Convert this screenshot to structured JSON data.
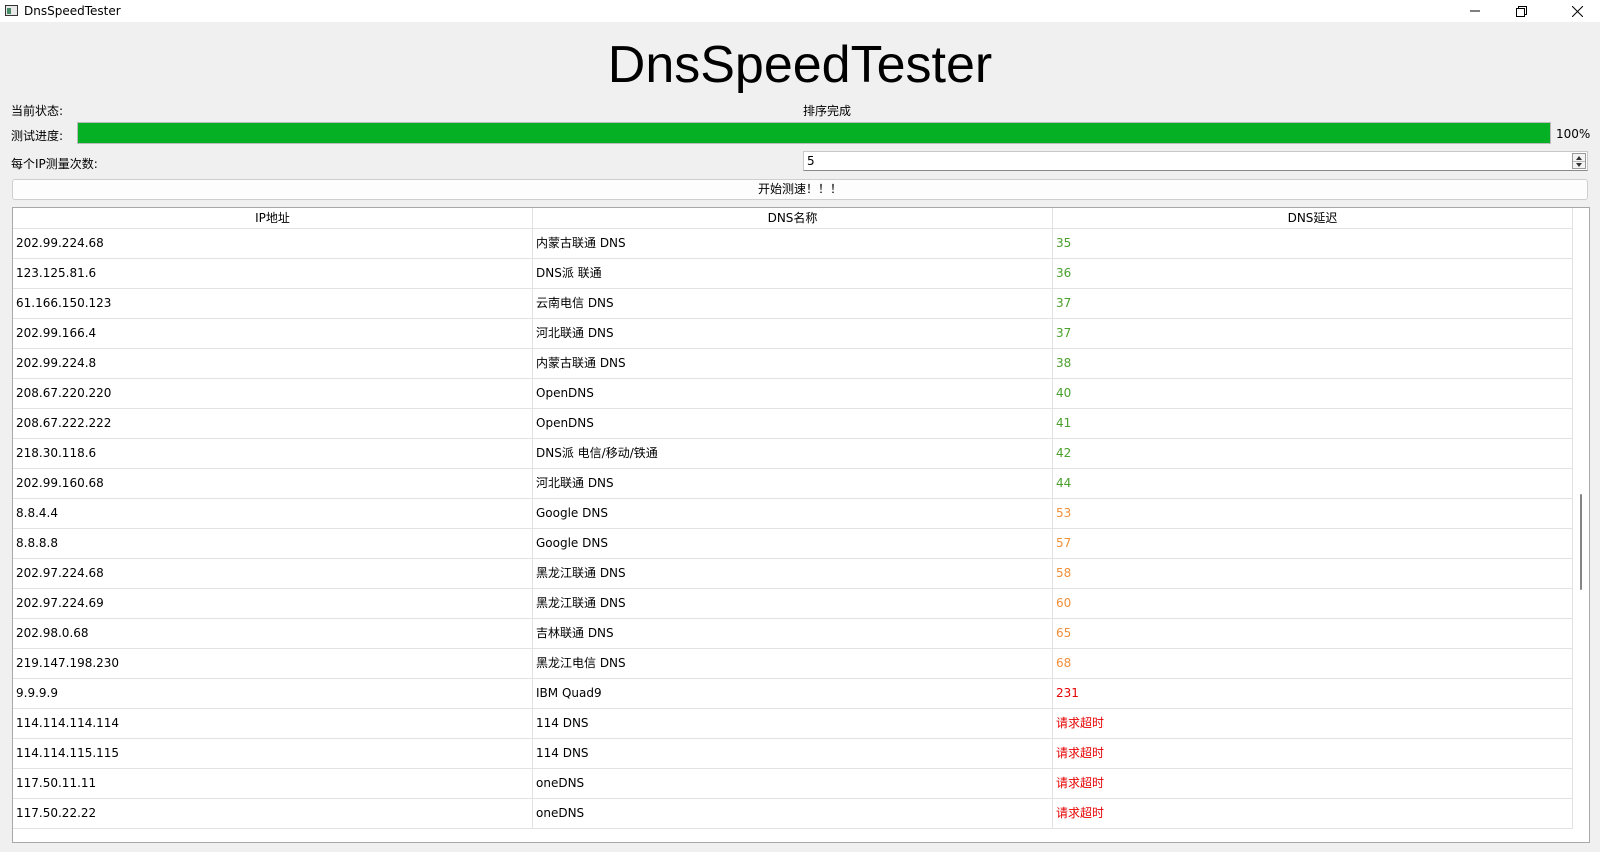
{
  "window": {
    "title": "DnsSpeedTester",
    "minimize_icon": "minimize-icon",
    "maximize_icon": "restore-icon",
    "close_icon": "close-icon"
  },
  "heading": "DnsSpeedTester",
  "status": {
    "label": "当前状态:",
    "value": "排序完成"
  },
  "progress": {
    "label": "测试进度:",
    "percent": 100,
    "text": "100%",
    "color": "#06b025"
  },
  "count": {
    "label": "每个IP测量次数:",
    "value": "5"
  },
  "start_button": "开始测速！！！",
  "table": {
    "columns": [
      "IP地址",
      "DNS名称",
      "DNS延迟"
    ],
    "latency_colors": {
      "good": "#4aa02c",
      "medium": "#f0903a",
      "bad": "#e60000"
    },
    "rows": [
      {
        "ip": "202.99.224.68",
        "name": "内蒙古联通 DNS",
        "latency": "35",
        "level": "good"
      },
      {
        "ip": "123.125.81.6",
        "name": "DNS派 联通",
        "latency": "36",
        "level": "good"
      },
      {
        "ip": "61.166.150.123",
        "name": "云南电信 DNS",
        "latency": "37",
        "level": "good"
      },
      {
        "ip": "202.99.166.4",
        "name": "河北联通 DNS",
        "latency": "37",
        "level": "good"
      },
      {
        "ip": "202.99.224.8",
        "name": "内蒙古联通 DNS",
        "latency": "38",
        "level": "good"
      },
      {
        "ip": "208.67.220.220",
        "name": "OpenDNS",
        "latency": "40",
        "level": "good"
      },
      {
        "ip": "208.67.222.222",
        "name": "OpenDNS",
        "latency": "41",
        "level": "good"
      },
      {
        "ip": "218.30.118.6",
        "name": "DNS派 电信/移动/铁通",
        "latency": "42",
        "level": "good"
      },
      {
        "ip": "202.99.160.68",
        "name": "河北联通 DNS",
        "latency": "44",
        "level": "good"
      },
      {
        "ip": "8.8.4.4",
        "name": "Google DNS",
        "latency": "53",
        "level": "medium"
      },
      {
        "ip": "8.8.8.8",
        "name": "Google DNS",
        "latency": "57",
        "level": "medium"
      },
      {
        "ip": "202.97.224.68",
        "name": "黑龙江联通 DNS",
        "latency": "58",
        "level": "medium"
      },
      {
        "ip": "202.97.224.69",
        "name": "黑龙江联通 DNS",
        "latency": "60",
        "level": "medium"
      },
      {
        "ip": "202.98.0.68",
        "name": "吉林联通 DNS",
        "latency": "65",
        "level": "medium"
      },
      {
        "ip": "219.147.198.230",
        "name": "黑龙江电信 DNS",
        "latency": "68",
        "level": "medium"
      },
      {
        "ip": "9.9.9.9",
        "name": "IBM Quad9",
        "latency": "231",
        "level": "bad"
      },
      {
        "ip": "114.114.114.114",
        "name": "114 DNS",
        "latency": "请求超时",
        "level": "bad"
      },
      {
        "ip": "114.114.115.115",
        "name": "114 DNS",
        "latency": "请求超时",
        "level": "bad"
      },
      {
        "ip": "117.50.11.11",
        "name": "oneDNS",
        "latency": "请求超时",
        "level": "bad"
      },
      {
        "ip": "117.50.22.22",
        "name": "oneDNS",
        "latency": "请求超时",
        "level": "bad"
      }
    ]
  }
}
